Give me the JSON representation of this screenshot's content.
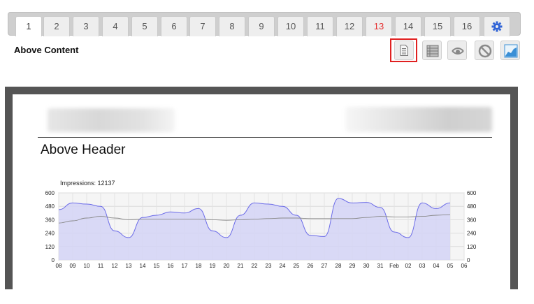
{
  "tabs": [
    {
      "label": "1",
      "active": true
    },
    {
      "label": "2"
    },
    {
      "label": "3"
    },
    {
      "label": "4"
    },
    {
      "label": "5"
    },
    {
      "label": "6"
    },
    {
      "label": "7"
    },
    {
      "label": "8"
    },
    {
      "label": "9"
    },
    {
      "label": "10"
    },
    {
      "label": "11"
    },
    {
      "label": "12"
    },
    {
      "label": "13",
      "highlight": true
    },
    {
      "label": "14"
    },
    {
      "label": "15"
    },
    {
      "label": "16"
    }
  ],
  "settings_icon": "gear-icon",
  "section_title": "Above Content",
  "toolbar": {
    "buttons": [
      {
        "name": "document-icon",
        "selected": true
      },
      {
        "name": "list-icon"
      },
      {
        "name": "eye-icon"
      },
      {
        "name": "block-icon"
      },
      {
        "name": "chart-icon"
      }
    ],
    "highlight_color": "#e02020"
  },
  "preview": {
    "heading": "Above Header"
  },
  "chart_data": {
    "type": "area",
    "title": "Impressions: 12137",
    "categories": [
      "08",
      "09",
      "10",
      "11",
      "12",
      "13",
      "14",
      "15",
      "16",
      "17",
      "18",
      "19",
      "20",
      "21",
      "22",
      "23",
      "24",
      "25",
      "26",
      "27",
      "28",
      "29",
      "30",
      "31",
      "Feb",
      "02",
      "03",
      "04",
      "05",
      "06"
    ],
    "ylim": [
      0,
      600
    ],
    "yticks": [
      0,
      120,
      240,
      360,
      480,
      600
    ],
    "grid": true,
    "series": [
      {
        "values": [
          450,
          510,
          500,
          480,
          260,
          200,
          380,
          400,
          430,
          420,
          460,
          260,
          200,
          400,
          510,
          500,
          480,
          400,
          220,
          210,
          550,
          510,
          515,
          470,
          250,
          200,
          510,
          460,
          510
        ]
      },
      {
        "values": [
          330,
          350,
          375,
          390,
          375,
          360,
          365,
          365,
          365,
          365,
          365,
          360,
          355,
          360,
          365,
          370,
          375,
          375,
          370,
          370,
          370,
          370,
          380,
          390,
          385,
          385,
          390,
          400,
          405
        ]
      }
    ],
    "colors": {
      "area": "#d4d4f6",
      "line": "#6b6be8",
      "trend": "#888888"
    }
  }
}
